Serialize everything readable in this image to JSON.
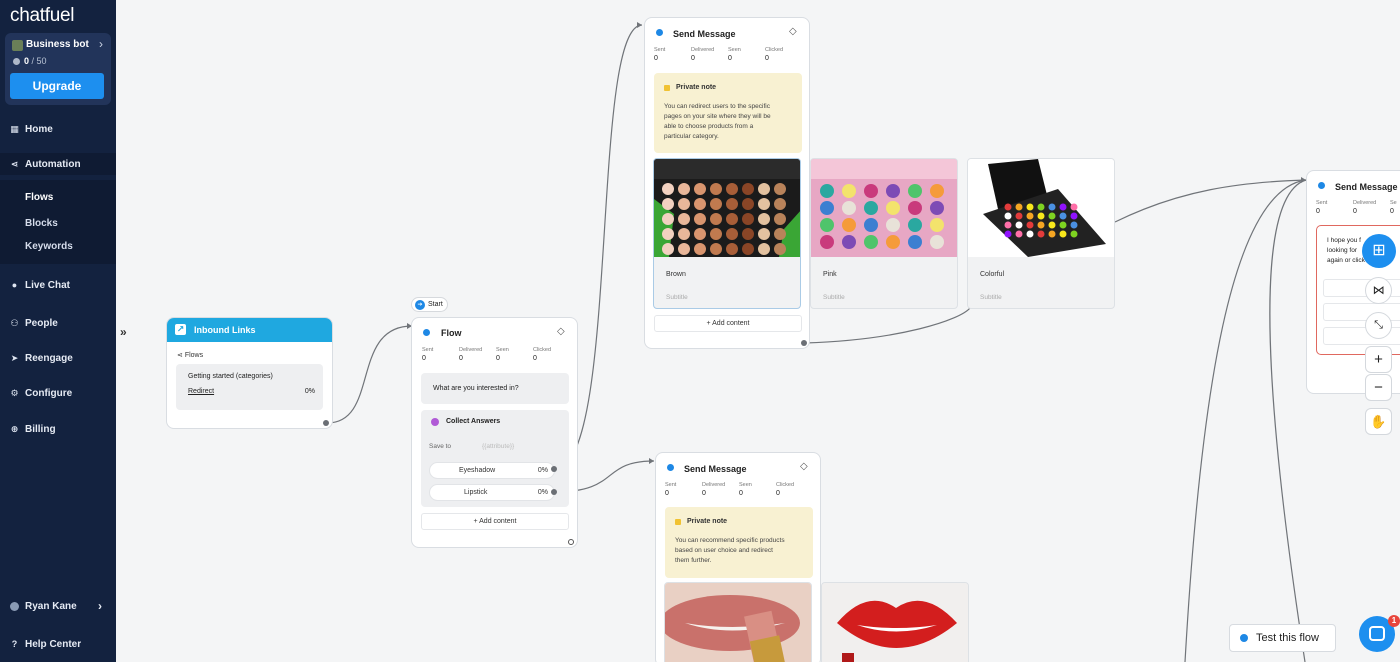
{
  "sidebar": {
    "logo": "chatfuel",
    "bot_name": "Business bot",
    "bot_count_used": "0",
    "bot_count_rest": " / 50",
    "upgrade_label": "Upgrade",
    "nav": [
      {
        "label": "Home",
        "icon": "home-icon"
      },
      {
        "label": "Automation",
        "icon": "automation-icon"
      },
      {
        "label": "Live Chat",
        "icon": "chat-icon"
      },
      {
        "label": "People",
        "icon": "people-icon"
      },
      {
        "label": "Reengage",
        "icon": "send-icon"
      },
      {
        "label": "Configure",
        "icon": "gear-icon"
      },
      {
        "label": "Billing",
        "icon": "billing-icon"
      }
    ],
    "automation_sub": [
      "Flows",
      "Blocks",
      "Keywords"
    ],
    "user_name": "Ryan Kane",
    "help_center": "Help Center"
  },
  "canvas": {
    "inbound": {
      "title": "Inbound Links",
      "flows_label": "Flows",
      "item_title": "Getting started (categories)",
      "item_link": "Redirect",
      "item_pct": "0%"
    },
    "start_label": "Start",
    "flow_card": {
      "title": "Flow",
      "stats": [
        {
          "l": "Sent",
          "v": "0"
        },
        {
          "l": "Delivered",
          "v": "0"
        },
        {
          "l": "Seen",
          "v": "0"
        },
        {
          "l": "Clicked",
          "v": "0"
        }
      ],
      "question": "What are you interested in?",
      "collect_title": "Collect Answers",
      "save_to": "Save to",
      "attribute": "{{attribute}}",
      "options": [
        {
          "label": "Eyeshadow",
          "pct": "0%"
        },
        {
          "label": "Lipstick",
          "pct": "0%"
        }
      ],
      "add_content": "+ Add content"
    },
    "msg1": {
      "title": "Send Message",
      "stats": [
        {
          "l": "Sent",
          "v": "0"
        },
        {
          "l": "Delivered",
          "v": "0"
        },
        {
          "l": "Seen",
          "v": "0"
        },
        {
          "l": "Clicked",
          "v": "0"
        }
      ],
      "note_title": "Private note",
      "note_lines": [
        "You can redirect users to the specific",
        "pages on your site where they will be",
        "able to choose products from a",
        "particular category."
      ],
      "gallery": [
        {
          "title": "Brown",
          "subtitle": "Subtitle"
        },
        {
          "title": "Pink",
          "subtitle": "Subtitle"
        },
        {
          "title": "Colorful",
          "subtitle": "Subtitle"
        }
      ],
      "add_content": "+ Add content"
    },
    "msg2": {
      "title": "Send Message",
      "stats": [
        {
          "l": "Sent",
          "v": "0"
        },
        {
          "l": "Delivered",
          "v": "0"
        },
        {
          "l": "Seen",
          "v": "0"
        },
        {
          "l": "Clicked",
          "v": "0"
        }
      ],
      "note_title": "Private note",
      "note_lines": [
        "You can recommend specific products",
        "based on user choice and redirect",
        "them further."
      ]
    },
    "msg3": {
      "title": "Send Message",
      "stats": [
        {
          "l": "Sent",
          "v": "0"
        },
        {
          "l": "Delivered",
          "v": "0"
        },
        {
          "l": "Se",
          "v": "0"
        }
      ],
      "text_lines": [
        "I hope you f",
        "looking for",
        "again or click"
      ]
    },
    "test_flow": "Test this flow",
    "chat_badge": "1"
  },
  "colors": {
    "sidebar_bg": "#13223f",
    "accent_blue": "#1d8fef",
    "inbound_header": "#1fa8e0"
  }
}
